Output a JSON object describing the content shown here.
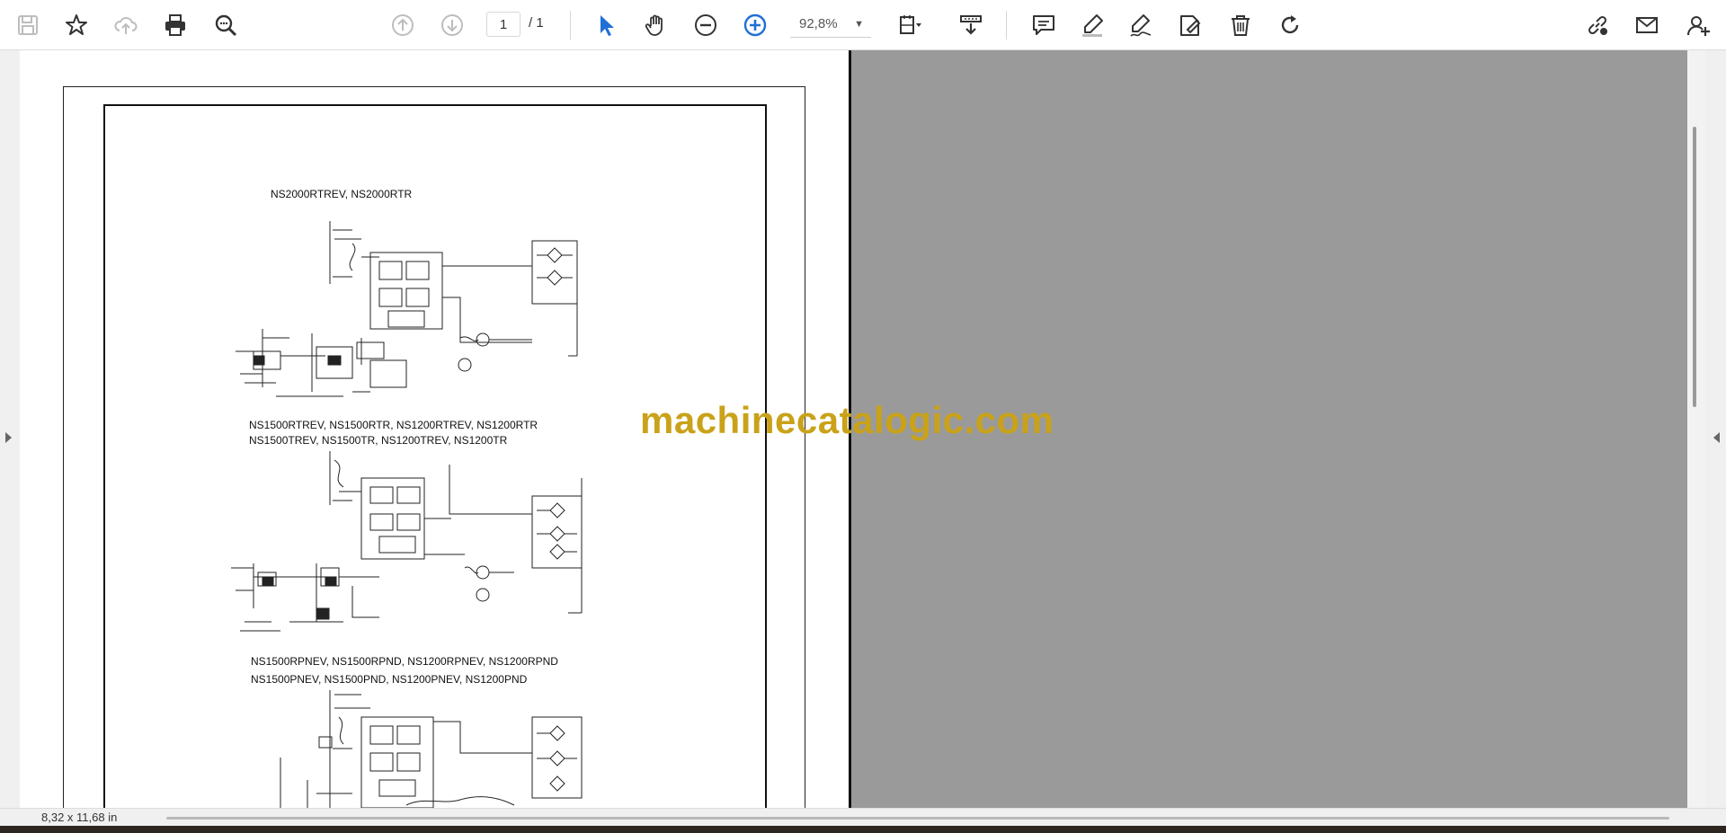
{
  "toolbar": {
    "current_page": "1",
    "page_total": "/ 1",
    "zoom": "92,8%",
    "tools": [
      "save-icon",
      "star-icon",
      "cloud-upload-icon",
      "print-icon",
      "zoom-search-icon",
      "page-up-icon",
      "page-down-icon",
      "select-cursor-icon",
      "hand-icon",
      "zoom-out-icon",
      "zoom-in-icon",
      "page-fit-icon",
      "scroll-mode-icon",
      "comment-icon",
      "highlight-icon",
      "sign-icon",
      "stamp-icon",
      "delete-icon",
      "rotate-icon",
      "share-link-icon",
      "email-icon",
      "add-user-icon"
    ]
  },
  "document": {
    "section1_title": "NS2000RTREV, NS2000RTR",
    "section2_line1": "NS1500RTREV, NS1500RTR, NS1200RTREV, NS1200RTR",
    "section2_line2": "NS1500TREV, NS1500TR, NS1200TREV, NS1200TR",
    "section3_line1": "NS1500RPNEV, NS1500RPND, NS1200RPNEV, NS1200RPND",
    "section3_line2": "NS1500PNEV, NS1500PND, NS1200PNEV, NS1200PND"
  },
  "watermark": "machinecatalogic.com",
  "status": {
    "page_size": "8,32 x 11,68 in"
  },
  "colors": {
    "accent": "#1f6fd6",
    "watermark": "#c9a21a",
    "background_gray": "#9a9a9a"
  }
}
